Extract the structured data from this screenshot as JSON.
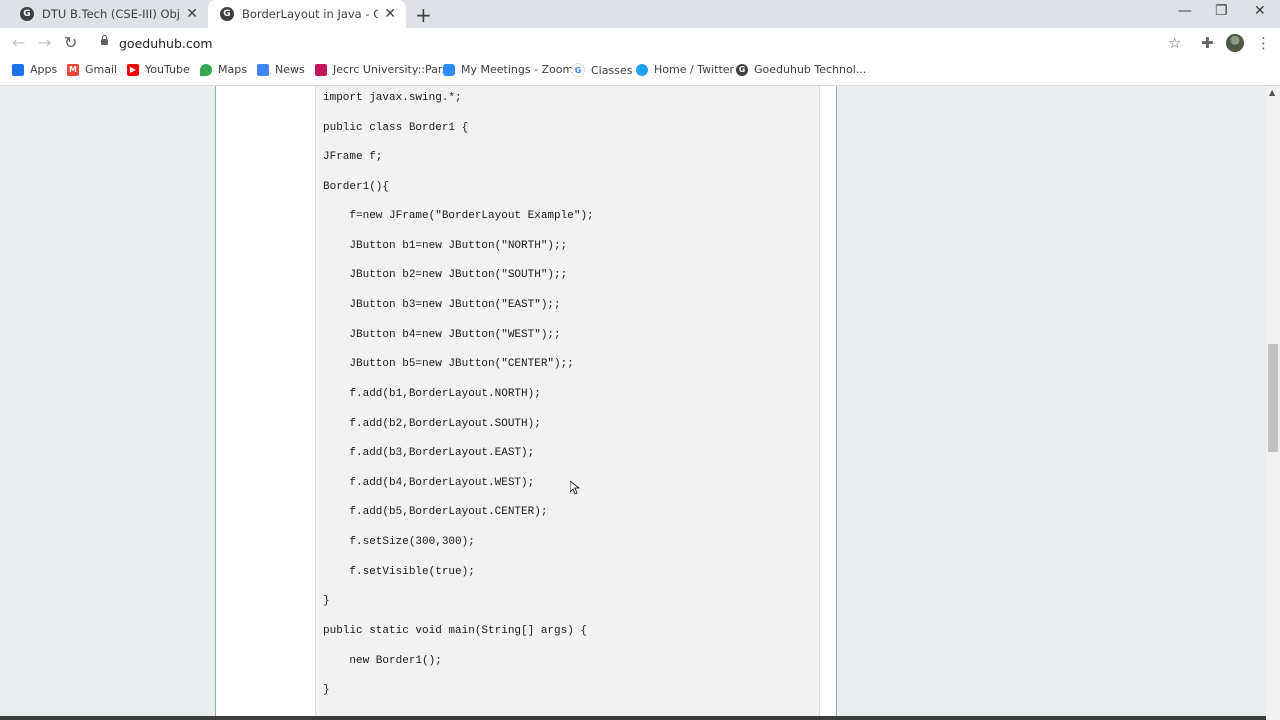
{
  "tabs": [
    {
      "favicon": "G",
      "title": "DTU B.Tech (CSE-III) Object Orien",
      "close": "✕"
    },
    {
      "favicon": "G",
      "title": "BorderLayout in Java - Goeduhub",
      "close": "✕"
    }
  ],
  "toolbar": {
    "new_tab": "+",
    "url": "goeduhub.com",
    "back": "←",
    "forward": "→",
    "reload": "↻",
    "star": "☆",
    "extensions": "✚",
    "menu": "⋮",
    "minimize": "—",
    "restore": "❐",
    "close": "✕"
  },
  "bookmarks": [
    {
      "label": "Apps",
      "icon": "apps-grid-icon",
      "color": "#1a73e8"
    },
    {
      "label": "Gmail",
      "icon": "gmail-icon",
      "color": "#ea4335"
    },
    {
      "label": "YouTube",
      "icon": "youtube-icon",
      "color": "#ff0000"
    },
    {
      "label": "Maps",
      "icon": "maps-icon",
      "color": "#34a853"
    },
    {
      "label": "News",
      "icon": "news-icon",
      "color": "#4285f4"
    },
    {
      "label": "Jecrc University::Par...",
      "icon": "jecrc-icon",
      "color": "#c2185b"
    },
    {
      "label": "My Meetings - Zoom",
      "icon": "zoom-icon",
      "color": "#2d8cff"
    },
    {
      "label": "Classes",
      "icon": "google-icon",
      "color": "#4285f4"
    },
    {
      "label": "Home / Twitter",
      "icon": "twitter-icon",
      "color": "#1da1f2"
    },
    {
      "label": "Goeduhub Technol...",
      "icon": "goeduhub-icon",
      "color": "#3c4043"
    }
  ],
  "code_lines": [
    "import javax.swing.*;",
    "public class Border1 {",
    "JFrame f;",
    "Border1(){",
    "    f=new JFrame(\"BorderLayout Example\");",
    "    JButton b1=new JButton(\"NORTH\");;",
    "    JButton b2=new JButton(\"SOUTH\");;",
    "    JButton b3=new JButton(\"EAST\");;",
    "    JButton b4=new JButton(\"WEST\");;",
    "    JButton b5=new JButton(\"CENTER\");;",
    "    f.add(b1,BorderLayout.NORTH);",
    "    f.add(b2,BorderLayout.SOUTH);",
    "    f.add(b3,BorderLayout.EAST);",
    "    f.add(b4,BorderLayout.WEST);",
    "    f.add(b5,BorderLayout.CENTER);",
    "    f.setSize(300,300);",
    "    f.setVisible(true);",
    "}",
    "public static void main(String[] args) {",
    "    new Border1();",
    "}"
  ],
  "colors": {
    "page_background": "#eaeeee",
    "content_border": "#7fb9b0",
    "code_background": "#f2f2f2"
  }
}
